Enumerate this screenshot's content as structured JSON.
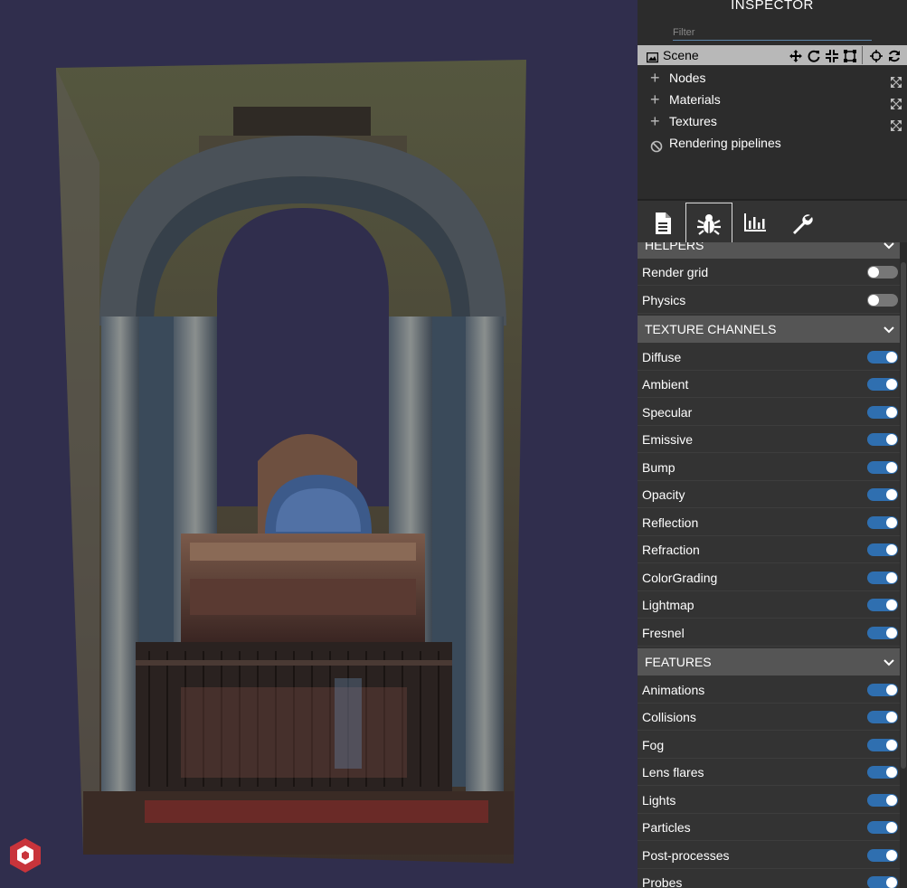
{
  "inspector": {
    "title": "INSPECTOR",
    "filter_placeholder": "Filter",
    "tree": {
      "scene_label": "Scene",
      "items": [
        {
          "label": "Nodes",
          "expandable": true
        },
        {
          "label": "Materials",
          "expandable": true
        },
        {
          "label": "Textures",
          "expandable": true
        },
        {
          "label": "Rendering pipelines",
          "expandable": false
        }
      ]
    },
    "tabs": [
      {
        "name": "properties",
        "icon": "file-text-icon"
      },
      {
        "name": "debug",
        "icon": "bug-icon",
        "active": true
      },
      {
        "name": "statistics",
        "icon": "chart-icon"
      },
      {
        "name": "tools",
        "icon": "wrench-icon"
      }
    ],
    "sections": {
      "helpers": {
        "title": "HELPERS",
        "options": [
          {
            "label": "Render grid",
            "on": false
          },
          {
            "label": "Physics",
            "on": false
          }
        ]
      },
      "texture_channels": {
        "title": "TEXTURE CHANNELS",
        "options": [
          {
            "label": "Diffuse",
            "on": true
          },
          {
            "label": "Ambient",
            "on": true
          },
          {
            "label": "Specular",
            "on": true
          },
          {
            "label": "Emissive",
            "on": true
          },
          {
            "label": "Bump",
            "on": true
          },
          {
            "label": "Opacity",
            "on": true
          },
          {
            "label": "Reflection",
            "on": true
          },
          {
            "label": "Refraction",
            "on": true
          },
          {
            "label": "ColorGrading",
            "on": true
          },
          {
            "label": "Lightmap",
            "on": true
          },
          {
            "label": "Fresnel",
            "on": true
          }
        ]
      },
      "features": {
        "title": "FEATURES",
        "options": [
          {
            "label": "Animations",
            "on": true
          },
          {
            "label": "Collisions",
            "on": true
          },
          {
            "label": "Fog",
            "on": true
          },
          {
            "label": "Lens flares",
            "on": true
          },
          {
            "label": "Lights",
            "on": true
          },
          {
            "label": "Particles",
            "on": true
          },
          {
            "label": "Post-processes",
            "on": true
          },
          {
            "label": "Probes",
            "on": true
          }
        ]
      }
    }
  },
  "colors": {
    "viewport_bg": "#302e4d",
    "toggle_on": "#2f6fb0",
    "toggle_off": "#777777",
    "logo": "#c8343b"
  }
}
